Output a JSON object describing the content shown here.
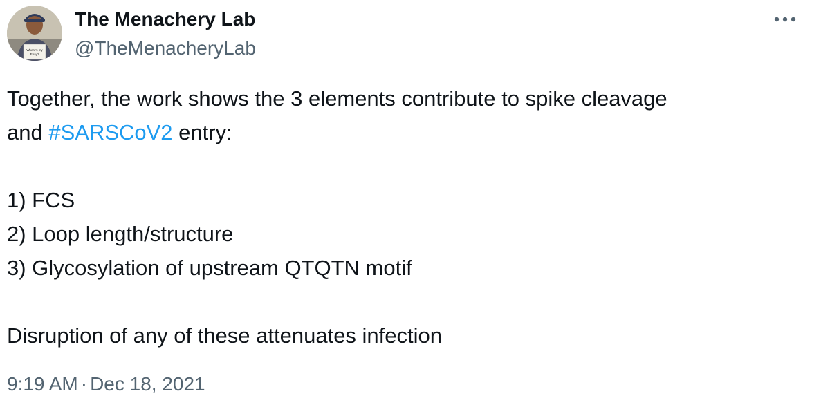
{
  "author": {
    "name": "The Menachery Lab",
    "handle": "@TheMenacheryLab",
    "avatar_sign_text": "Where's my Ebay?"
  },
  "more_icon": "more-horizontal-icon",
  "tweet": {
    "line1": "Together, the work shows the 3 elements contribute to spike cleavage",
    "line2_prefix": "and ",
    "hashtag": "#SARSCoV2",
    "line2_suffix": " entry:",
    "items": [
      "1) FCS",
      "2) Loop length/structure",
      "3) Glycosylation of upstream QTQTN motif"
    ],
    "conclusion": "Disruption of any of these attenuates infection"
  },
  "meta": {
    "time": "9:19 AM",
    "separator": "·",
    "date": "Dec 18, 2021"
  },
  "colors": {
    "text": "#0f1419",
    "secondary": "#536471",
    "link": "#1d9bf0"
  }
}
